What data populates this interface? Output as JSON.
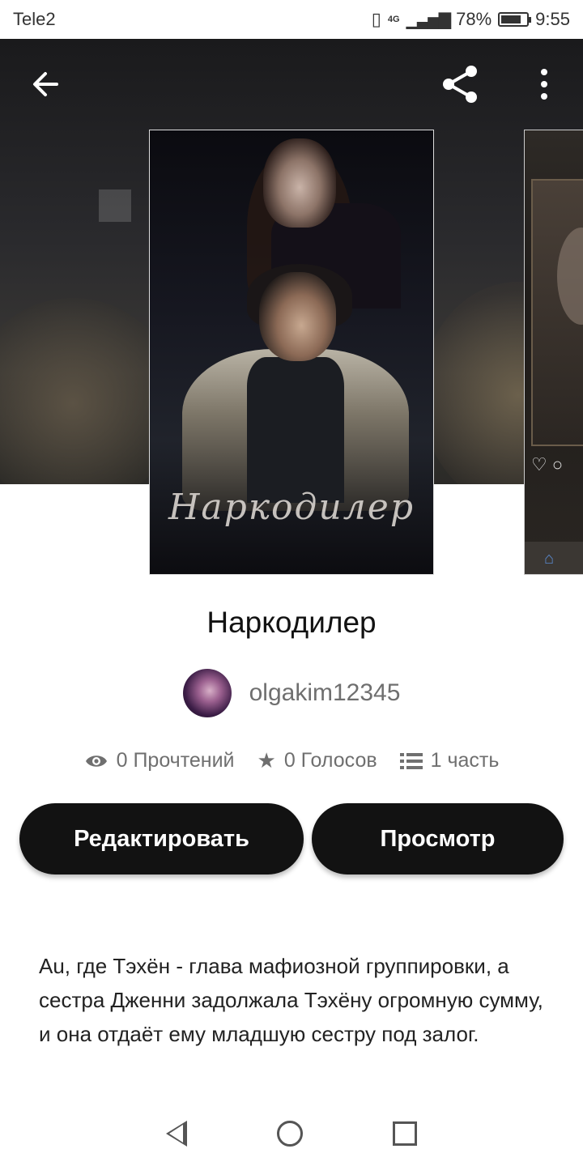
{
  "status_bar": {
    "carrier": "Tele2",
    "network": "4G",
    "battery": "78%",
    "battery_level": 0.78,
    "time": "9:55"
  },
  "header": {
    "back_icon": "arrow-left-icon",
    "share_icon": "share-icon",
    "more_icon": "more-vertical-icon"
  },
  "cover": {
    "title_art": "Наркодилер"
  },
  "story": {
    "title": "Наркодилер",
    "author": "olgakim12345",
    "stats": {
      "reads": "0 Прочтений",
      "votes": "0 Голосов",
      "parts": "1 часть"
    },
    "edit_label": "Редактировать",
    "view_label": "Просмотр",
    "description": "Au, где Тэхён - глава мафиозной группировки, а сестра Дженни задолжала Тэхёну огромную сумму, и она отдаёт ему младшую сестру под залог."
  },
  "colors": {
    "button_bg": "#121212",
    "muted_text": "#6f6f6f"
  }
}
